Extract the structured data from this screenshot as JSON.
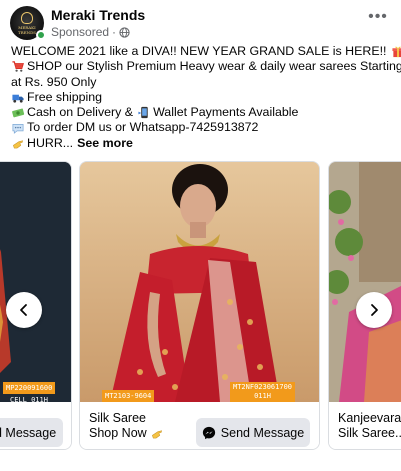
{
  "post": {
    "page_name": "Meraki Trends",
    "sponsored": "Sponsored",
    "avatar_text": "MERAKI TRENDS",
    "more_label": "•••",
    "lines": [
      {
        "icon": "",
        "text": "WELCOME 2021 like a DIVA!! NEW YEAR GRAND SALE is HERE!!",
        "trail_icon": "gift-icon"
      },
      {
        "icon": "shopping-cart-icon",
        "text": "SHOP our Stylish Premium Heavy wear & daily wear sarees Starting"
      },
      {
        "icon": "",
        "text": "at Rs. 950 Only"
      },
      {
        "icon": "truck-icon",
        "text": "Free shipping"
      },
      {
        "icon": "money-icon",
        "text": "Cash on Delivery &"
      },
      {
        "icon": "speech-bubble-icon",
        "text": "To order DM us or Whatsapp-7425913872"
      },
      {
        "icon": "pointing-hand-icon",
        "text": "HURR..."
      }
    ],
    "wallet_text": "Wallet Payments Available",
    "see_more": "See more"
  },
  "carousel": {
    "left": {
      "cta": "d Message",
      "sku1": "MP220091600",
      "sku2": "CELL 011H"
    },
    "center": {
      "title_line1": "Silk Saree",
      "title_line2": "Shop Now",
      "cta": "Send Message",
      "sku1": "MT2103-9604",
      "sku2_line1": "MT2NF023061700",
      "sku2_line2": "011H"
    },
    "right": {
      "title_line1": "Kanjeevaran",
      "title_line2": "Silk Saree..."
    }
  },
  "colors": {
    "accent": "#f29a1b",
    "button_bg": "#e4e6eb",
    "online": "#31a24c",
    "muted_text": "#65676b"
  }
}
